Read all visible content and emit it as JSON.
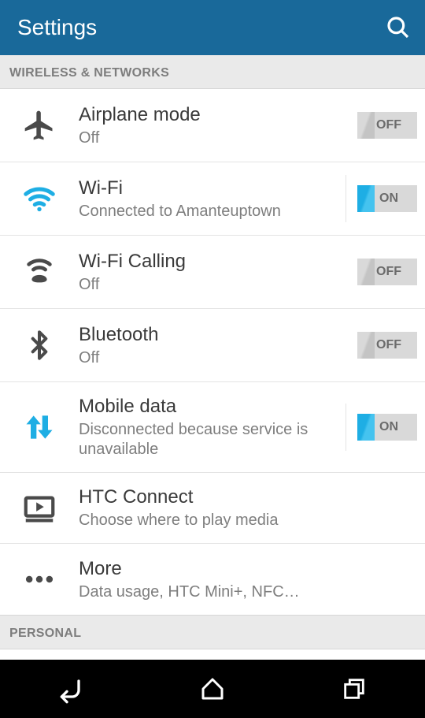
{
  "header": {
    "title": "Settings"
  },
  "sections": {
    "wireless": {
      "header": "WIRELESS & NETWORKS"
    },
    "personal": {
      "header": "PERSONAL"
    }
  },
  "items": {
    "airplane": {
      "title": "Airplane mode",
      "subtitle": "Off",
      "toggle": "OFF"
    },
    "wifi": {
      "title": "Wi-Fi",
      "subtitle": "Connected to Amanteuptown",
      "toggle": "ON"
    },
    "wificalling": {
      "title": "Wi-Fi Calling",
      "subtitle": "Off",
      "toggle": "OFF"
    },
    "bluetooth": {
      "title": "Bluetooth",
      "subtitle": "Off",
      "toggle": "OFF"
    },
    "mobiledata": {
      "title": "Mobile data",
      "subtitle": "Disconnected because service is unavailable",
      "toggle": "ON"
    },
    "htcconnect": {
      "title": "HTC Connect",
      "subtitle": "Choose where to play media"
    },
    "more": {
      "title": "More",
      "subtitle": "Data usage, HTC Mini+, NFC…"
    }
  },
  "colors": {
    "accent": "#19699a",
    "active": "#1eaee4"
  }
}
